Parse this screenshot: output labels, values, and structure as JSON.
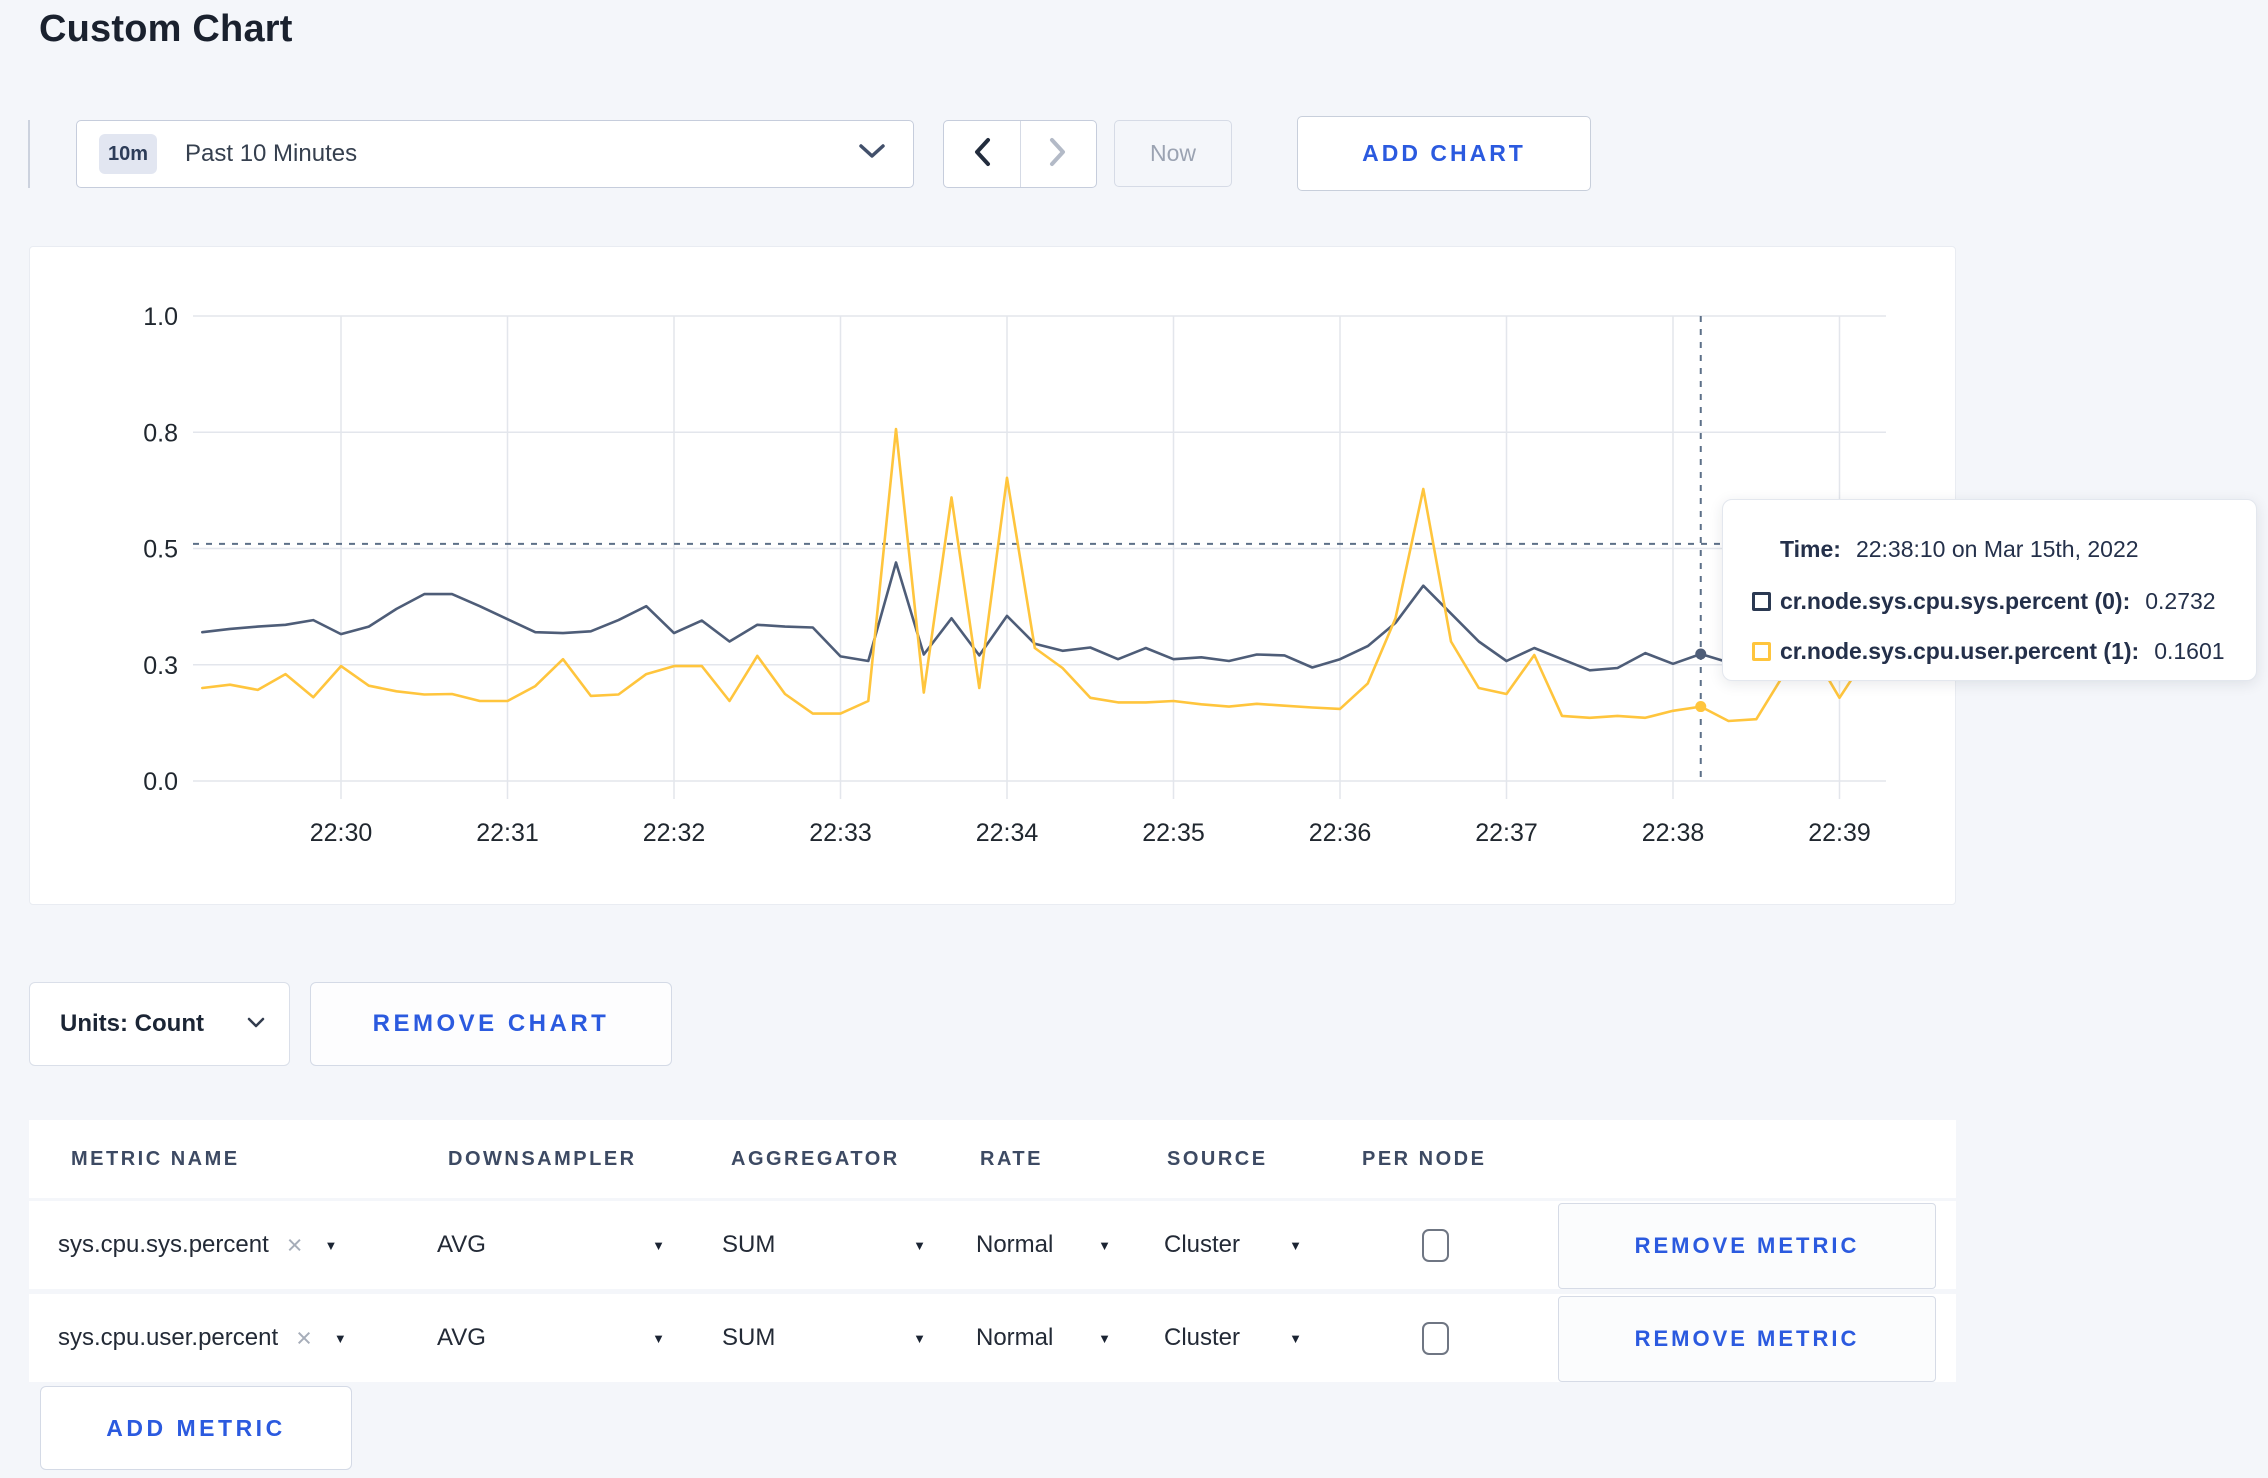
{
  "page": {
    "title": "Custom Chart"
  },
  "colors": {
    "accent_blue": "#2b5adf",
    "series_sys": "#4e5d78",
    "series_user": "#ffc53d",
    "grid": "#e3e6ec",
    "crosshair": "#5d7088"
  },
  "icons": {
    "caret_down": "▼",
    "remove_x": "×"
  },
  "toolbar": {
    "time_range_badge": "10m",
    "time_range_label": "Past 10 Minutes",
    "now_label": "Now",
    "add_chart_label": "ADD CHART"
  },
  "chart_data": {
    "type": "line",
    "title": "",
    "xlabel": "",
    "ylabel": "",
    "ylim": [
      0,
      1
    ],
    "grid": true,
    "legend_position": "none",
    "x_ticks": [
      "22:30",
      "22:31",
      "22:32",
      "22:33",
      "22:34",
      "22:35",
      "22:36",
      "22:37",
      "22:38",
      "22:39"
    ],
    "y_ticks": [
      {
        "label": "0.0",
        "value": 0
      },
      {
        "label": "0.3",
        "value": 0.25
      },
      {
        "label": "0.5",
        "value": 0.5
      },
      {
        "label": "0.8",
        "value": 0.75
      },
      {
        "label": "1.0",
        "value": 1
      }
    ],
    "x_start": "22:29:10",
    "interval_seconds": 10,
    "series": [
      {
        "name": "cr.node.sys.cpu.sys.percent",
        "color": "#4e5d78",
        "values": [
          0.32,
          0.327,
          0.332,
          0.336,
          0.346,
          0.316,
          0.332,
          0.37,
          0.402,
          0.402,
          0.376,
          0.348,
          0.32,
          0.318,
          0.322,
          0.346,
          0.376,
          0.318,
          0.345,
          0.3,
          0.336,
          0.332,
          0.33,
          0.268,
          0.258,
          0.47,
          0.272,
          0.35,
          0.27,
          0.355,
          0.295,
          0.28,
          0.287,
          0.262,
          0.286,
          0.262,
          0.266,
          0.258,
          0.272,
          0.27,
          0.244,
          0.262,
          0.29,
          0.34,
          0.42,
          0.36,
          0.3,
          0.258,
          0.286,
          0.262,
          0.238,
          0.243,
          0.275,
          0.252,
          0.2732,
          0.255,
          0.275,
          0.295,
          0.3,
          0.295,
          0.305
        ]
      },
      {
        "name": "cr.node.sys.cpu.user.percent",
        "color": "#ffc53d",
        "values": [
          0.2,
          0.207,
          0.196,
          0.23,
          0.18,
          0.247,
          0.205,
          0.193,
          0.186,
          0.187,
          0.172,
          0.172,
          0.204,
          0.262,
          0.183,
          0.186,
          0.23,
          0.247,
          0.247,
          0.172,
          0.269,
          0.187,
          0.145,
          0.145,
          0.172,
          0.757,
          0.19,
          0.61,
          0.2,
          0.652,
          0.286,
          0.243,
          0.179,
          0.169,
          0.169,
          0.172,
          0.165,
          0.16,
          0.166,
          0.162,
          0.158,
          0.155,
          0.21,
          0.35,
          0.628,
          0.3,
          0.2,
          0.187,
          0.271,
          0.14,
          0.136,
          0.14,
          0.136,
          0.151,
          0.1601,
          0.129,
          0.133,
          0.23,
          0.28,
          0.179,
          0.27
        ]
      }
    ],
    "crosshair": {
      "time": "22:38:10",
      "hline_value": 0.51
    }
  },
  "tooltip": {
    "time_label": "Time:",
    "time_value": "22:38:10 on Mar 15th, 2022",
    "rows": [
      {
        "label": "cr.node.sys.cpu.sys.percent (0):",
        "value": "0.2732",
        "color": "#2b3952"
      },
      {
        "label": "cr.node.sys.cpu.user.percent (1):",
        "value": "0.1601",
        "color": "#ffc53d"
      }
    ]
  },
  "chart_controls": {
    "units_label": "Units: Count",
    "remove_chart_label": "REMOVE CHART"
  },
  "metrics_table": {
    "headers": [
      "METRIC NAME",
      "DOWNSAMPLER",
      "AGGREGATOR",
      "RATE",
      "SOURCE",
      "PER NODE"
    ],
    "rows": [
      {
        "metric": "sys.cpu.sys.percent",
        "downsampler": "AVG",
        "aggregator": "SUM",
        "rate": "Normal",
        "source": "Cluster",
        "per_node": false,
        "remove_label": "REMOVE METRIC"
      },
      {
        "metric": "sys.cpu.user.percent",
        "downsampler": "AVG",
        "aggregator": "SUM",
        "rate": "Normal",
        "source": "Cluster",
        "per_node": false,
        "remove_label": "REMOVE METRIC"
      }
    ],
    "add_metric_label": "ADD METRIC"
  }
}
